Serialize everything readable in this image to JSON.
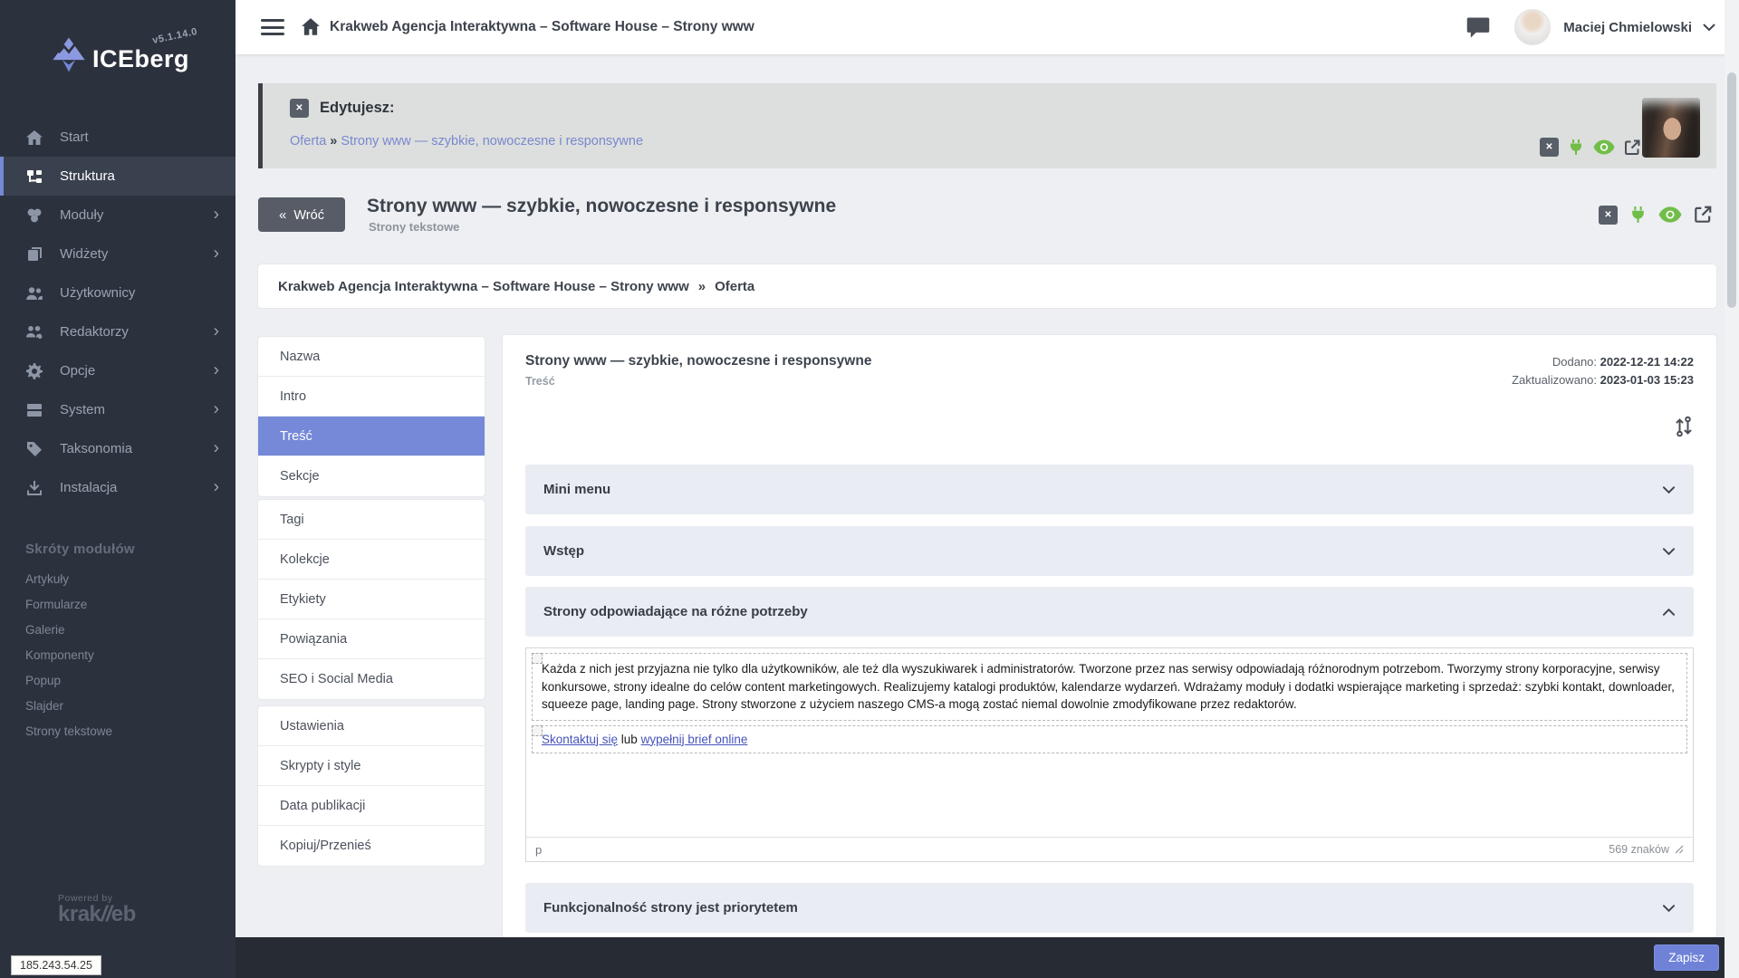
{
  "app": {
    "name": "ICEberg",
    "version": "v5.1.14.0",
    "powered_by_label": "Powered by",
    "powered_by_brand_left": "krak",
    "powered_by_brand_slashes": "//",
    "powered_by_brand_right": "eb",
    "server_ip": "185.243.54.25"
  },
  "topbar": {
    "breadcrumb": "Krakweb Agencja Interaktywna – Software House – Strony www",
    "user": {
      "name": "Maciej Chmielowski"
    }
  },
  "sidebar": {
    "items": [
      {
        "label": "Start",
        "icon": "home-icon",
        "active": false,
        "has_submenu": false
      },
      {
        "label": "Struktura",
        "icon": "structure-icon",
        "active": true,
        "has_submenu": false
      },
      {
        "label": "Moduły",
        "icon": "modules-icon",
        "active": false,
        "has_submenu": true
      },
      {
        "label": "Widżety",
        "icon": "widgets-icon",
        "active": false,
        "has_submenu": true
      },
      {
        "label": "Użytkownicy",
        "icon": "users-icon",
        "active": false,
        "has_submenu": false
      },
      {
        "label": "Redaktorzy",
        "icon": "editors-icon",
        "active": false,
        "has_submenu": true
      },
      {
        "label": "Opcje",
        "icon": "gear-icon",
        "active": false,
        "has_submenu": true
      },
      {
        "label": "System",
        "icon": "server-icon",
        "active": false,
        "has_submenu": true
      },
      {
        "label": "Taksonomia",
        "icon": "tags-icon",
        "active": false,
        "has_submenu": true
      },
      {
        "label": "Instalacja",
        "icon": "install-icon",
        "active": false,
        "has_submenu": true
      }
    ],
    "submenu_arrow": "›",
    "shortcuts_header": "Skróty modułów",
    "shortcuts": [
      "Artykuły",
      "Formularze",
      "Galerie",
      "Komponenty",
      "Popup",
      "Slajder",
      "Strony tekstowe"
    ]
  },
  "edit_banner": {
    "label": "Edytujesz:",
    "close_glyph": "✕",
    "link_parent": "Oferta",
    "separator": "»",
    "link_page": "Strony www — szybkie, nowoczesne i responsywne"
  },
  "page_header": {
    "back_arrows": "«",
    "back_button": "Wróć",
    "title": "Strony www — szybkie, nowoczesne i responsywne",
    "subtitle": "Strony tekstowe"
  },
  "breadcrumb_bar": {
    "path": "Krakweb Agencja Interaktywna – Software House – Strony www",
    "separator": "»",
    "current": "Oferta"
  },
  "tabs": {
    "active": "Treść",
    "group1": [
      "Nazwa",
      "Intro",
      "Treść",
      "Sekcje"
    ],
    "group2": [
      "Tagi",
      "Kolekcje",
      "Etykiety",
      "Powiązania",
      "SEO i Social Media"
    ],
    "group3": [
      "Ustawienia",
      "Skrypty i style",
      "Data publikacji",
      "Kopiuj/Przenieś"
    ]
  },
  "content": {
    "title": "Strony www — szybkie, nowoczesne i responsywne",
    "subtitle": "Treść",
    "added_label": "Dodano:",
    "added_value": "2022-12-21 14:22",
    "updated_label": "Zaktualizowano:",
    "updated_value": "2023-01-03 15:23",
    "accordions": [
      {
        "title": "Mini menu",
        "expanded": false
      },
      {
        "title": "Wstęp",
        "expanded": false
      },
      {
        "title": "Strony odpowiadające na różne potrzeby",
        "expanded": true
      },
      {
        "title": "Funkcjonalność strony jest priorytetem",
        "expanded": false
      }
    ],
    "editor": {
      "paragraph": "Każda z nich jest przyjazna nie tylko dla użytkowników, ale też dla wyszukiwarek i administratorów. Tworzone przez nas serwisy odpowiadają różnorodnym potrzebom. Tworzymy strony korporacyjne, serwisy konkursowe, strony idealne do celów content marketingowych. Realizujemy katalogi produktów, kalendarze wydarzeń. Wdrażamy moduły i dodatki wspierające marketing i sprzedaż: szybki kontakt, downloader, squeeze page, landing page. Strony stworzone z użyciem naszego CMS-a mogą zostać niemal dowolnie zmodyfikowane przez redaktorów.",
      "link_contact": "Skontaktuj się",
      "link_separator": " lub ",
      "link_brief": "wypełnij brief online",
      "element_tag": "p",
      "char_count": "569 znaków"
    }
  },
  "footer": {
    "save_button": "Zapisz"
  },
  "colors": {
    "accent": "#7589d8",
    "green": "#72bd4a",
    "sidebar_bg": "#2c323d",
    "footer_bg": "#272b33"
  }
}
